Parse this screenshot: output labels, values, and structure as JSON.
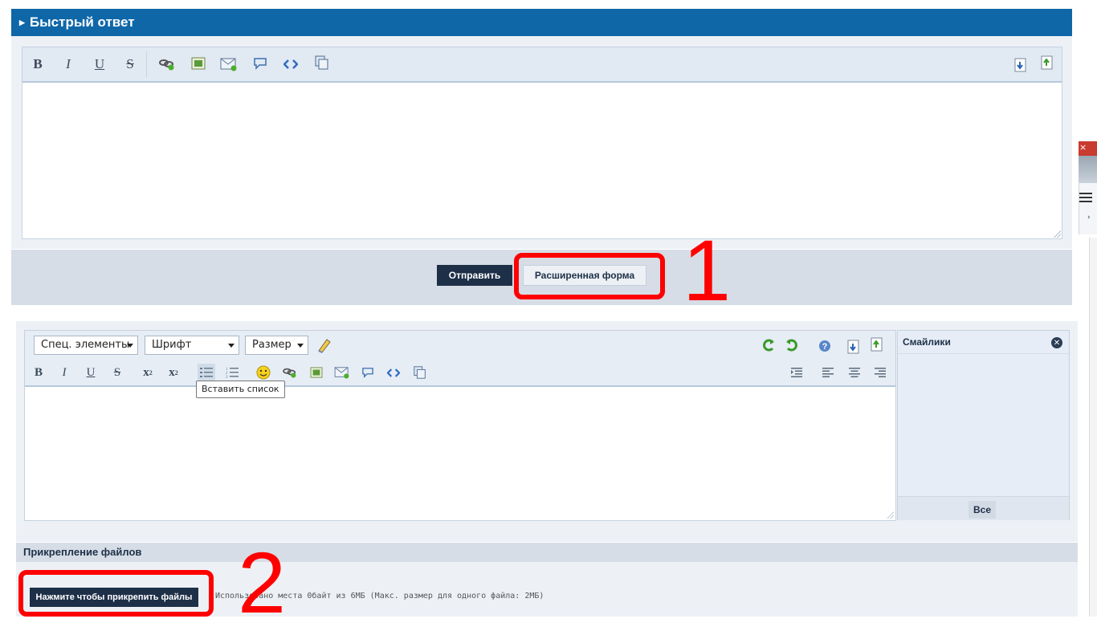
{
  "quick_reply": {
    "title": "Быстрый ответ",
    "toolbar": {
      "bold": "B",
      "italic": "I",
      "underline": "U",
      "strike": "S",
      "icons": [
        "link-icon",
        "image-icon",
        "email-icon",
        "quote-icon",
        "code-icon",
        "copy-icon",
        "load-draft-icon",
        "save-draft-icon"
      ]
    },
    "send_label": "Отправить",
    "extended_label": "Расширенная форма",
    "annotation": "1"
  },
  "extended_editor": {
    "select_special": "Спец. элементы",
    "select_font": "Шрифт",
    "select_size": "Размер",
    "toolbar": {
      "bold": "B",
      "italic": "I",
      "underline": "U",
      "strike": "S",
      "sub": "x",
      "sub_small": "2",
      "sup": "x",
      "sup_small": "2"
    },
    "tooltip": "Вставить список",
    "smilies": {
      "title": "Смайлики",
      "all_label": "Все"
    }
  },
  "attachments": {
    "title": "Прикрепление файлов",
    "button_label": "Нажмите чтобы прикрепить файлы",
    "usage_text": "Использовано места 0байт из 6МБ (Макс. размер для одного файла: 2МБ)",
    "annotation": "2"
  },
  "colors": {
    "header_blue": "#0f67a8",
    "dark_button": "#1e3048",
    "highlight_red": "#ff0000"
  }
}
